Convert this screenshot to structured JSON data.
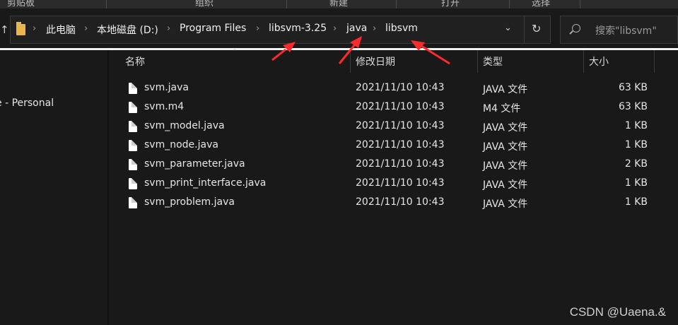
{
  "ribbon": {
    "groups": [
      "剪贴板",
      "组织",
      "新建",
      "打开",
      "选择"
    ]
  },
  "address_bar": {
    "breadcrumbs": [
      "此电脑",
      "本地磁盘 (D:)",
      "Program Files",
      "libsvm-3.25",
      "java",
      "libsvm"
    ]
  },
  "search": {
    "placeholder": "搜索\"libsvm\""
  },
  "nav_pane": {
    "items": [
      "e - Personal"
    ]
  },
  "columns": {
    "name": "名称",
    "modified": "修改日期",
    "type": "类型",
    "size": "大小"
  },
  "files": [
    {
      "name": "svm.java",
      "modified": "2021/11/10 10:43",
      "type": "JAVA 文件",
      "size": "63 KB"
    },
    {
      "name": "svm.m4",
      "modified": "2021/11/10 10:43",
      "type": "M4 文件",
      "size": "63 KB"
    },
    {
      "name": "svm_model.java",
      "modified": "2021/11/10 10:43",
      "type": "JAVA 文件",
      "size": "1 KB"
    },
    {
      "name": "svm_node.java",
      "modified": "2021/11/10 10:43",
      "type": "JAVA 文件",
      "size": "1 KB"
    },
    {
      "name": "svm_parameter.java",
      "modified": "2021/11/10 10:43",
      "type": "JAVA 文件",
      "size": "2 KB"
    },
    {
      "name": "svm_print_interface.java",
      "modified": "2021/11/10 10:43",
      "type": "JAVA 文件",
      "size": "1 KB"
    },
    {
      "name": "svm_problem.java",
      "modified": "2021/11/10 10:43",
      "type": "JAVA 文件",
      "size": "1 KB"
    }
  ],
  "watermark": "CSDN @Uaena.&",
  "colors": {
    "background": "#191919",
    "folder": "#e8b64c",
    "annotation_arrow": "#ff2a2a"
  }
}
